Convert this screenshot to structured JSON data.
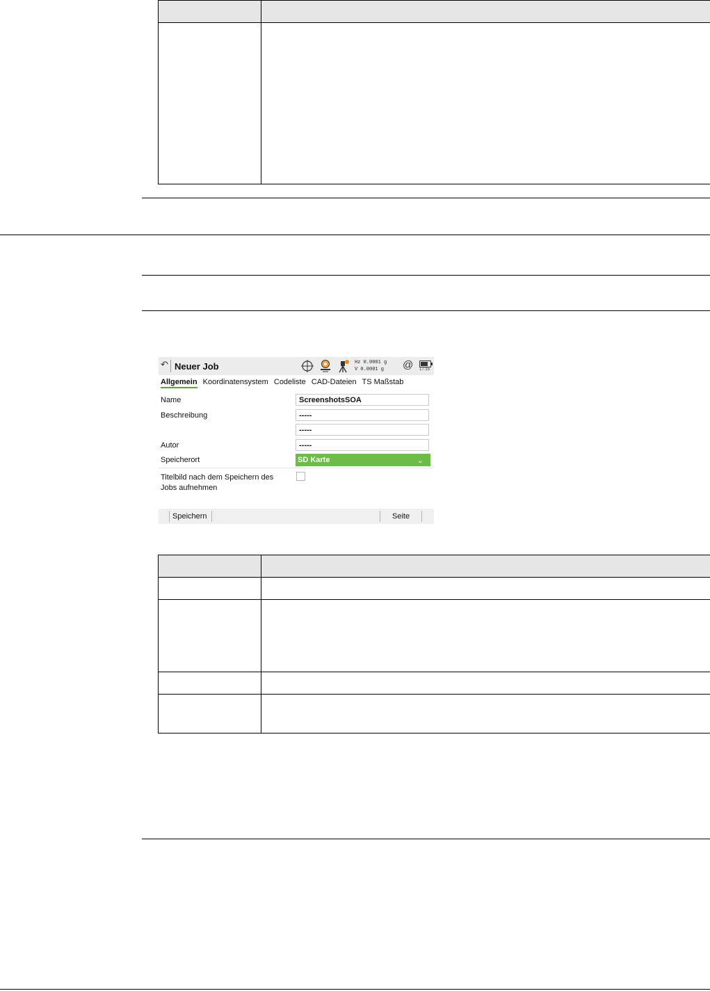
{
  "screen": {
    "title": "Neuer Job",
    "angles": {
      "hz": "Hz 0.0001 g",
      "v": "V   0.0001 g"
    },
    "time": "17:15",
    "tabs": [
      "Allgemein",
      "Koordinatensystem",
      "Codeliste",
      "CAD-Dateien",
      "TS Maßstab"
    ],
    "fields": {
      "name_label": "Name",
      "name_value": "ScreenshotsSOA",
      "beschreibung_label": "Beschreibung",
      "beschreibung_value1": "-----",
      "beschreibung_value2": "-----",
      "autor_label": "Autor",
      "autor_value": "-----",
      "speicherort_label": "Speicherort",
      "speicherort_value": "SD Karte",
      "titelbild_label_line1": "Titelbild nach dem Speichern des",
      "titelbild_label_line2": "Jobs aufnehmen",
      "titelbild_checked": false
    },
    "softkeys": {
      "save": "Speichern",
      "page": "Seite"
    }
  }
}
